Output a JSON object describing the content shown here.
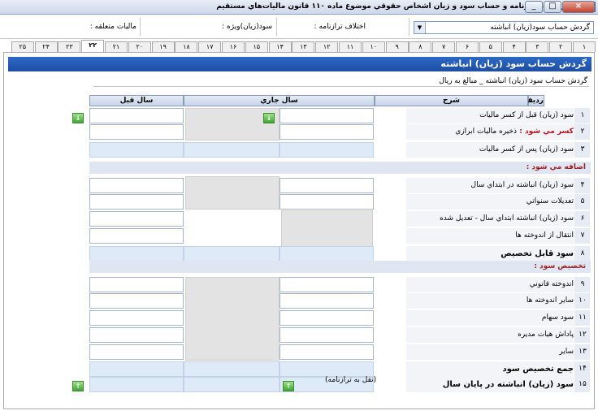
{
  "window": {
    "title": "اظهارنامه ، ترازنامه و حساب سود و زيان اشخاص حقوقي موضوع ماده ۱۱۰ قانون ماليات‌هاي مستقيم",
    "minimize": "_",
    "maximize": "□",
    "close": "×"
  },
  "topbar": {
    "combo_value": "گردش حساب سود(زيان) انباشته",
    "discrepancy_label": "اختلاف ترازنامه :",
    "special_profit_label": "سود(زيان)ويژه :",
    "tax_label": "ماليات متعلقه :"
  },
  "tabs": [
    "۱",
    "۲",
    "۳",
    "۴",
    "۵",
    "۶",
    "۷",
    "۸",
    "۹",
    "۱۰",
    "۱۱",
    "۱۲",
    "۱۳",
    "۱۴",
    "۱۵",
    "۱۶",
    "۱۷",
    "۱۸",
    "۱۹",
    "۲۰",
    "۲۱",
    "۲۲",
    "۲۳",
    "۲۴",
    "۲۵"
  ],
  "active_tab": "۲۲",
  "form": {
    "header": "گردش حساب سود (زيان) انباشته",
    "subtitle": "گردش حساب سود (زيان) انباشته _ مبالغ به ريال",
    "col_row": "رديف",
    "col_desc": "شرح",
    "col_current": "سال جاري",
    "col_previous": "سال قبل",
    "rows": [
      {
        "num": "۱",
        "label": "سود (زيان) قبل از كسر ماليات"
      },
      {
        "num": "۲",
        "label_red": "كسر مي شود :",
        "label": "ذخيره ماليات ابرازي"
      },
      {
        "num": "۳",
        "label": "سود (زيان) پس از كسر ماليات"
      },
      {
        "num": "۴",
        "label": "سود (زيان) انباشته در ابتداي سال"
      },
      {
        "num": "۵",
        "label": "تعديلات سنواتي"
      },
      {
        "num": "۶",
        "label": "سود (زيان) انباشته ابتداي سال - تعديل شده"
      },
      {
        "num": "۷",
        "label": "انتقال از اندوخته ها"
      },
      {
        "num": "۸",
        "label": "سود قابل تخصيص"
      },
      {
        "num": "۹",
        "label": "اندوخته قانوني"
      },
      {
        "num": "۱۰",
        "label": "ساير اندوخته ها"
      },
      {
        "num": "۱۱",
        "label": "سود سهام"
      },
      {
        "num": "۱۲",
        "label": "پاداش هيات مديره"
      },
      {
        "num": "۱۳",
        "label": "ساير"
      },
      {
        "num": "۱۴",
        "label": "جمع تخصيص سود"
      },
      {
        "num": "۱۵",
        "label": "سود (زيان) انباشته در پايان سال"
      }
    ],
    "section_add": "اضافه مي شود :",
    "section_alloc": "تخصيص سود :",
    "transfer_note": "(نقل به ترازنامه)"
  }
}
